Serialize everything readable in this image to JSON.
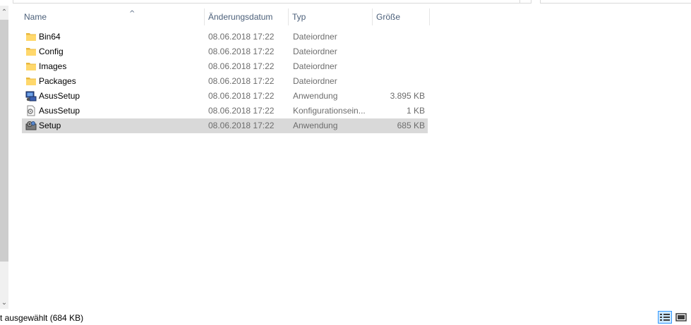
{
  "columns": {
    "name": "Name",
    "date": "Änderungsdatum",
    "type": "Typ",
    "size": "Größe"
  },
  "sort_indicator": "^",
  "files": [
    {
      "name": "Bin64",
      "date": "08.06.2018 17:22",
      "type": "Dateiordner",
      "size": "",
      "icon": "folder-icon"
    },
    {
      "name": "Config",
      "date": "08.06.2018 17:22",
      "type": "Dateiordner",
      "size": "",
      "icon": "folder-icon"
    },
    {
      "name": "Images",
      "date": "08.06.2018 17:22",
      "type": "Dateiordner",
      "size": "",
      "icon": "folder-icon"
    },
    {
      "name": "Packages",
      "date": "08.06.2018 17:22",
      "type": "Dateiordner",
      "size": "",
      "icon": "folder-icon"
    },
    {
      "name": "AsusSetup",
      "date": "08.06.2018 17:22",
      "type": "Anwendung",
      "size": "3.895 KB",
      "icon": "installer-app-icon"
    },
    {
      "name": "AsusSetup",
      "date": "08.06.2018 17:22",
      "type": "Konfigurationsein...",
      "size": "1 KB",
      "icon": "config-file-icon"
    },
    {
      "name": "Setup",
      "date": "08.06.2018 17:22",
      "type": "Anwendung",
      "size": "685 KB",
      "icon": "setup-app-icon",
      "selected": true
    }
  ],
  "status_bar": {
    "selection_text": "t ausgewählt (684 KB)"
  },
  "view_buttons": {
    "details": "details-view-icon",
    "tiles": "large-icons-view-icon",
    "active": "details"
  },
  "colors": {
    "header_text": "#4c607a",
    "secondary_text": "#6d6d6d",
    "selected_row": "#d9d9d9",
    "folder_yellow": "#ffd86c",
    "accent": "#3399ff"
  }
}
